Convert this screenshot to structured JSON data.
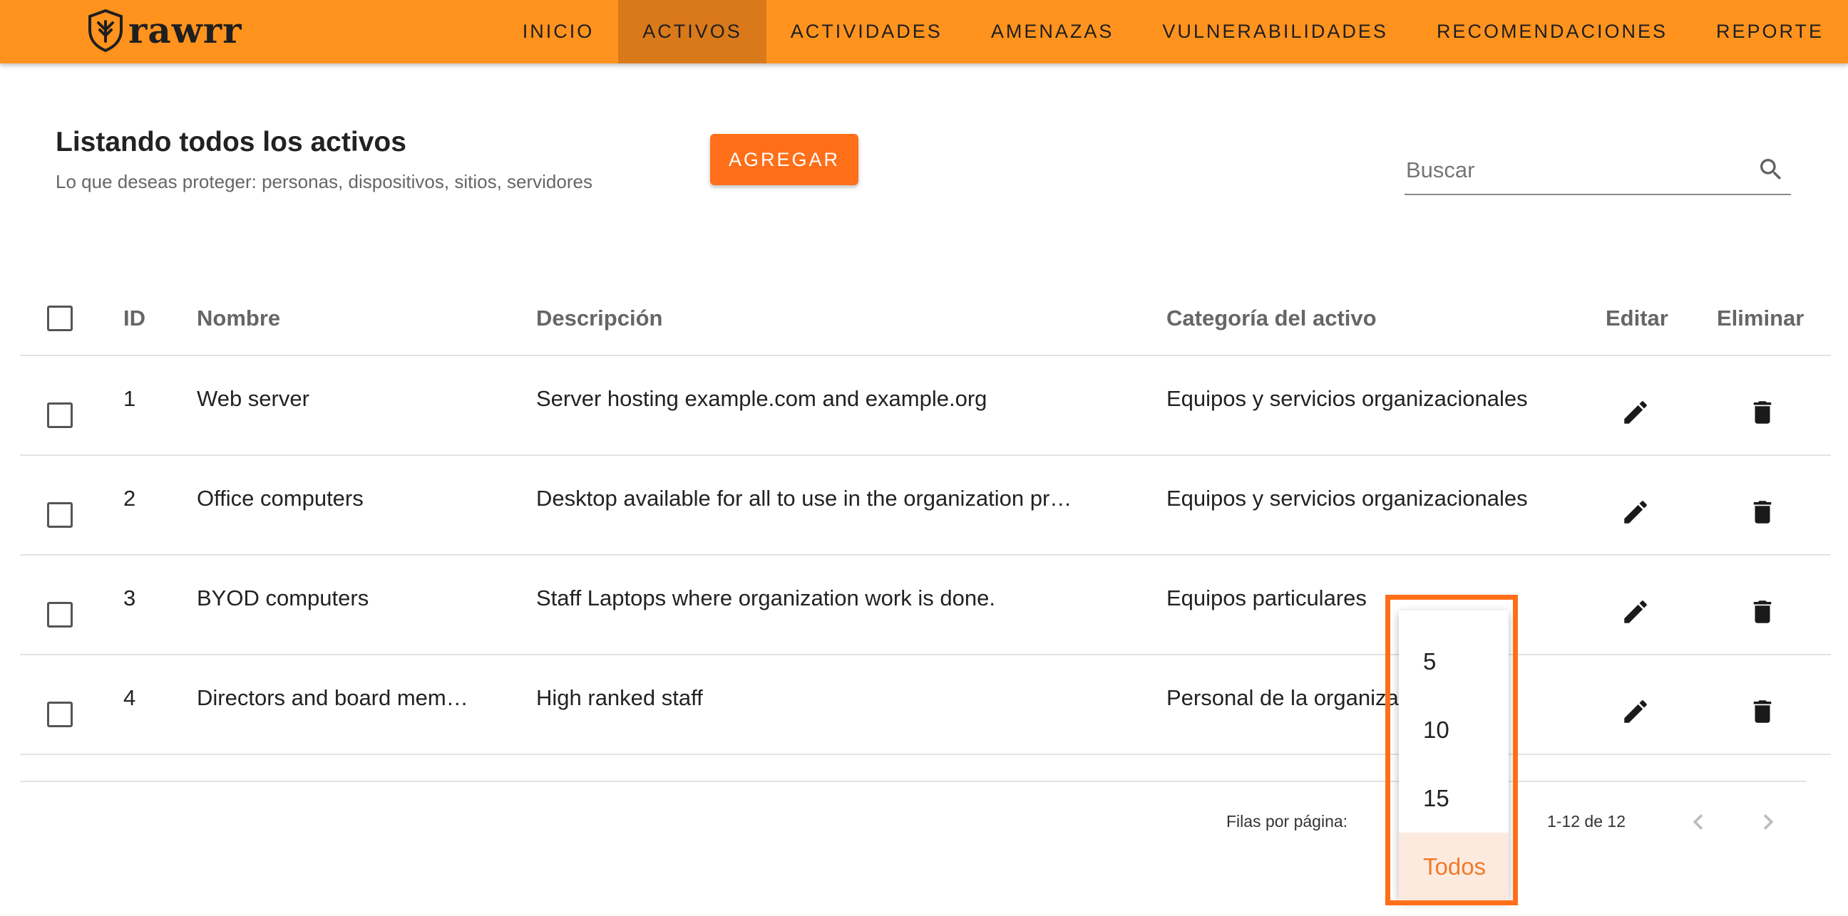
{
  "app": {
    "name": "rawrr",
    "accent": "#ff931e",
    "button_color": "#ff6f1a"
  },
  "nav": {
    "items": [
      {
        "label": "INICIO",
        "active": false
      },
      {
        "label": "ACTIVOS",
        "active": true
      },
      {
        "label": "ACTIVIDADES",
        "active": false
      },
      {
        "label": "AMENAZAS",
        "active": false
      },
      {
        "label": "VULNERABILIDADES",
        "active": false
      },
      {
        "label": "RECOMENDACIONES",
        "active": false
      },
      {
        "label": "REPORTE",
        "active": false
      }
    ]
  },
  "page": {
    "title": "Listando todos los activos",
    "subtitle": "Lo que deseas proteger: personas, dispositivos, sitios, servidores",
    "add_label": "AGREGAR"
  },
  "search": {
    "placeholder": "Buscar",
    "icon": "search-icon"
  },
  "table": {
    "headers": {
      "id": "ID",
      "name": "Nombre",
      "description": "Descripción",
      "category": "Categoría del activo",
      "edit": "Editar",
      "delete": "Eliminar"
    },
    "rows": [
      {
        "id": "1",
        "name": "Web server",
        "description": "Server hosting example.com and example.org",
        "category": "Equipos y servicios organizacionales"
      },
      {
        "id": "2",
        "name": "Office computers",
        "description": "Desktop available for all to use in the organization pr…",
        "category": "Equipos y servicios organizacionales"
      },
      {
        "id": "3",
        "name": "BYOD computers",
        "description": "Staff Laptops where organization work is done.",
        "category": "Equipos particulares"
      },
      {
        "id": "4",
        "name": "Directors and board mem…",
        "description": "High ranked staff",
        "category": "Personal de la organiza"
      }
    ]
  },
  "pagination": {
    "rows_per_page_label": "Filas por página:",
    "range_label": "1-12 de 12",
    "options": [
      "5",
      "10",
      "15",
      "Todos"
    ],
    "selected": "Todos"
  }
}
